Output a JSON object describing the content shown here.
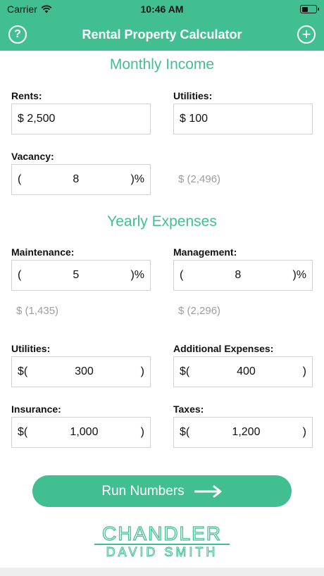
{
  "status": {
    "carrier": "Carrier",
    "time": "10:46 AM",
    "battery_level": 0.45
  },
  "nav": {
    "title": "Rental Property Calculator",
    "help_label": "?",
    "add_label": "+"
  },
  "monthly_income": {
    "title": "Monthly Income",
    "rents": {
      "label": "Rents:",
      "value": "$ 2,500"
    },
    "utilities": {
      "label": "Utilities:",
      "value": "$ 100"
    },
    "vacancy": {
      "label": "Vacancy:",
      "prefix": "(",
      "value": "8",
      "suffix": ")%",
      "computed": "$ (2,496)"
    }
  },
  "yearly_expenses": {
    "title": "Yearly Expenses",
    "maintenance": {
      "label": "Maintenance:",
      "prefix": "(",
      "value": "5",
      "suffix": ")%",
      "computed": "$ (1,435)"
    },
    "management": {
      "label": "Management:",
      "prefix": "(",
      "value": "8",
      "suffix": ")%",
      "computed": "$ (2,296)"
    },
    "utilities": {
      "label": "Utilities:",
      "prefix": "$(",
      "value": "300",
      "suffix": ")"
    },
    "additional": {
      "label": "Additional Expenses:",
      "prefix": "$(",
      "value": "400",
      "suffix": ")"
    },
    "insurance": {
      "label": "Insurance:",
      "prefix": "$(",
      "value": "1,000",
      "suffix": ")"
    },
    "taxes": {
      "label": "Taxes:",
      "prefix": "$(",
      "value": "1,200",
      "suffix": ")"
    }
  },
  "actions": {
    "run_label": "Run Numbers"
  },
  "logo": {
    "line1": "CHANDLER",
    "line2": "DAVID SMITH"
  },
  "colors": {
    "accent": "#41bf91",
    "muted_text": "#9d9d9d",
    "field_border": "#d2d2d2"
  }
}
